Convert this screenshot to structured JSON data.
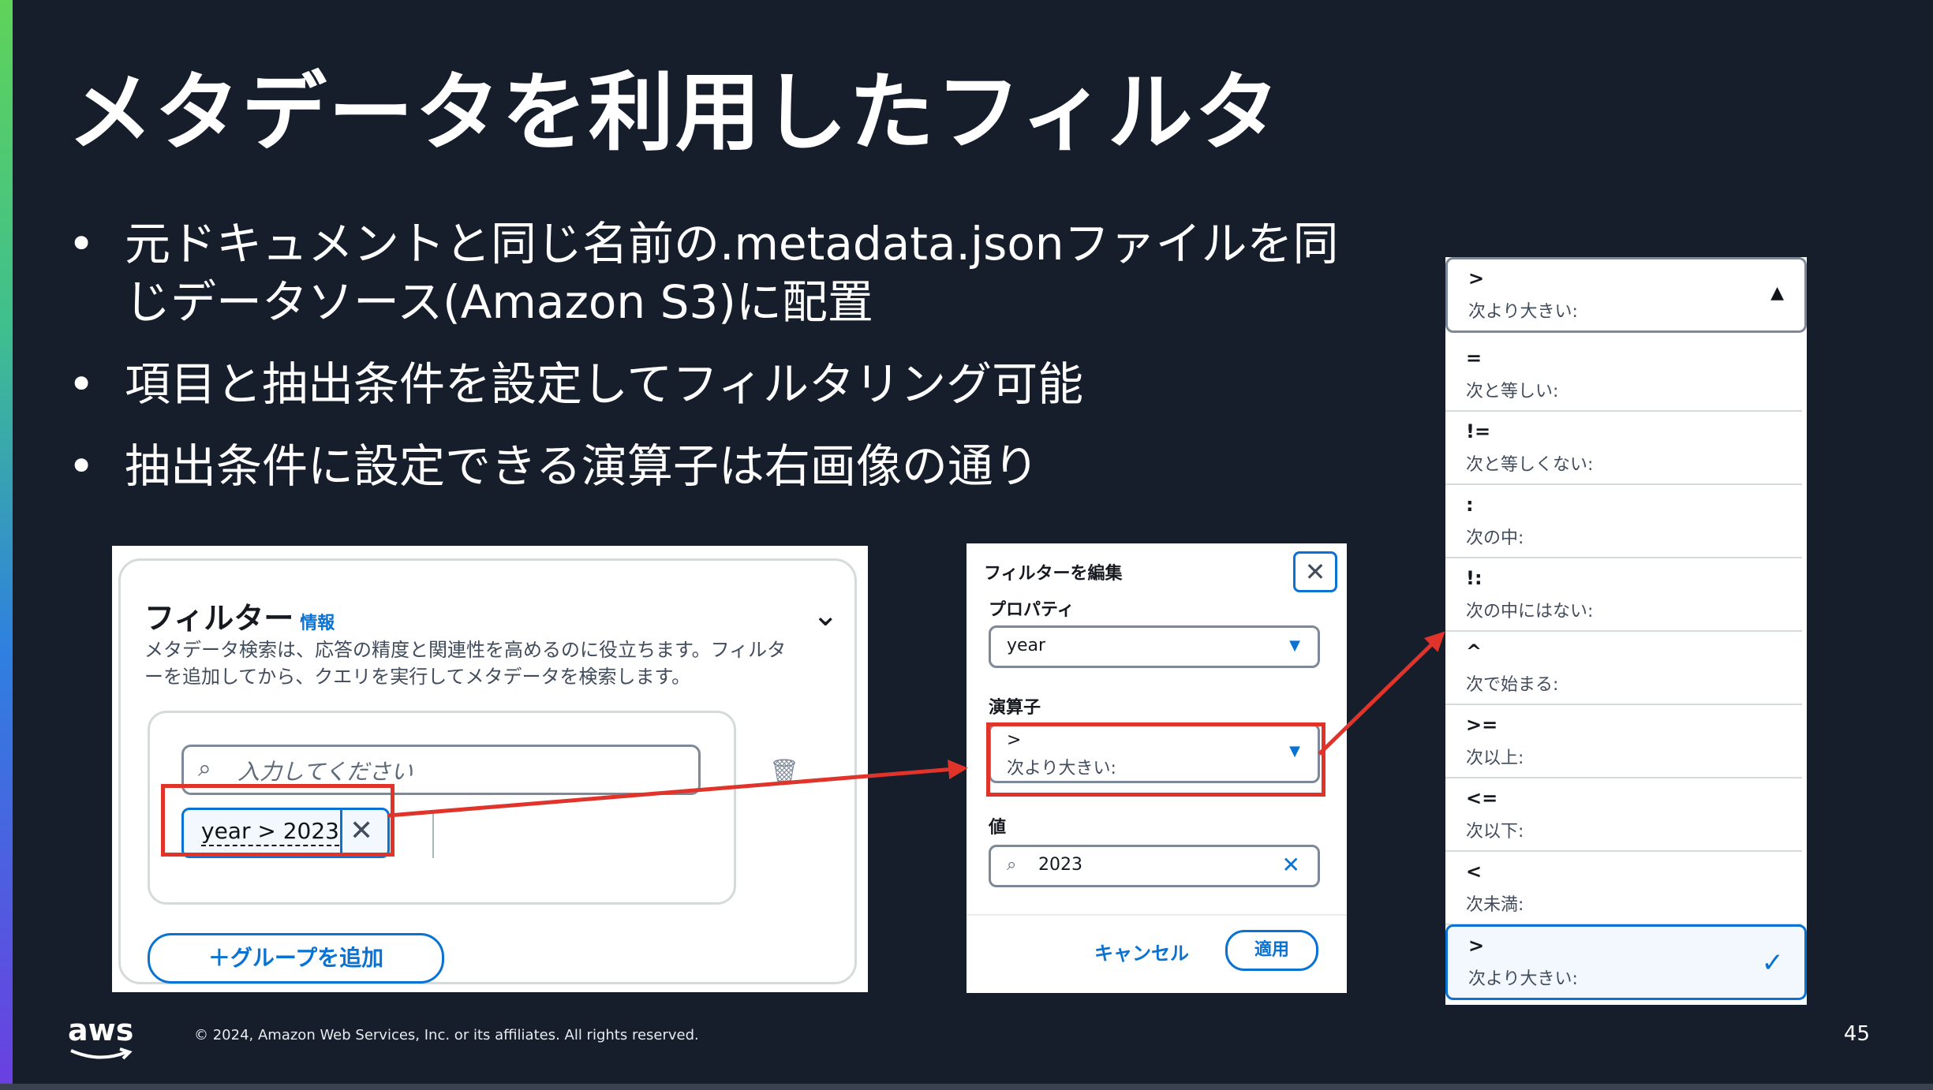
{
  "slide": {
    "title": "メタデータを利用したフィルタ",
    "bullets": [
      "元ドキュメントと同じ名前の.metadata.jsonファイルを同じデータソース(Amazon S3)に配置",
      "項目と抽出条件を設定してフィルタリング可能",
      "抽出条件に設定できる演算子は右画像の通り"
    ]
  },
  "filter_panel": {
    "title": "フィルター",
    "info_link": "情報",
    "description": "メタデータ検索は、応答の精度と関連性を高めるのに役立ちます。フィルターを追加してから、クエリを実行してメタデータを検索します。",
    "search_placeholder": "入力してください",
    "token_label": "year > 2023",
    "add_group_button": "＋グループを追加"
  },
  "edit_dialog": {
    "title": "フィルターを編集",
    "property_label": "プロパティ",
    "property_value": "year",
    "operator_label": "演算子",
    "operator_symbol": ">",
    "operator_text": "次より大きい:",
    "value_label": "値",
    "value": "2023",
    "cancel_button": "キャンセル",
    "apply_button": "適用"
  },
  "operator_list": {
    "current": {
      "symbol": ">",
      "text": "次より大きい:"
    },
    "options": [
      {
        "symbol": "=",
        "text": "次と等しい:"
      },
      {
        "symbol": "!=",
        "text": "次と等しくない:"
      },
      {
        "symbol": ":",
        "text": "次の中:"
      },
      {
        "symbol": "!:",
        "text": "次の中にはない:"
      },
      {
        "symbol": "^",
        "text": "次で始まる:"
      },
      {
        "symbol": ">=",
        "text": "次以上:"
      },
      {
        "symbol": "<=",
        "text": "次以下:"
      },
      {
        "symbol": "<",
        "text": "次未満:"
      },
      {
        "symbol": ">",
        "text": "次より大きい:"
      }
    ],
    "selected_index": 8
  },
  "footer": {
    "logo": "aws",
    "copyright": "© 2024, Amazon Web Services, Inc. or its affiliates. All rights reserved.",
    "page_number": "45"
  },
  "colors": {
    "background": "#161d2b",
    "highlight_red": "#e0342b",
    "link_blue": "#0972d3"
  },
  "icons": [
    "search-icon",
    "close-icon",
    "trash-icon",
    "chevron-down-icon",
    "caret-down-icon",
    "caret-up-icon",
    "check-icon",
    "plus-icon"
  ]
}
